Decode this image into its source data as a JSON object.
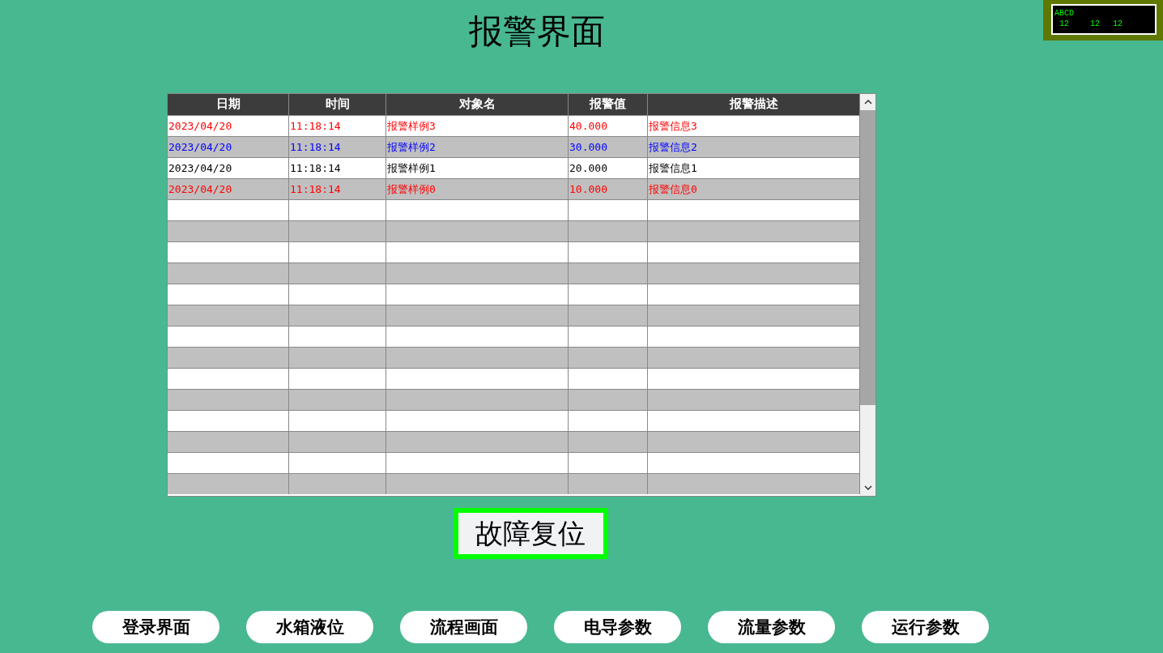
{
  "title": "报警界面",
  "display": {
    "line_1": "ABCD",
    "values": [
      "12",
      "12",
      "12"
    ]
  },
  "table": {
    "columns": [
      "日期",
      "时间",
      "对象名",
      "报警值",
      "报警描述"
    ],
    "rows": [
      {
        "cells": [
          "2023/04/20",
          "11:18:14",
          "报警样例3",
          "40.000",
          "报警信息3"
        ],
        "color": "#ff0000"
      },
      {
        "cells": [
          "2023/04/20",
          "11:18:14",
          "报警样例2",
          "30.000",
          "报警信息2"
        ],
        "color": "#0000ff"
      },
      {
        "cells": [
          "2023/04/20",
          "11:18:14",
          "报警样例1",
          "20.000",
          "报警信息1"
        ],
        "color": "#000000"
      },
      {
        "cells": [
          "2023/04/20",
          "11:18:14",
          "报警样例0",
          "10.000",
          "报警信息0"
        ],
        "color": "#ff0000"
      }
    ]
  },
  "reset_button": "故障复位",
  "nav_buttons": [
    "登录界面",
    "水箱液位",
    "流程画面",
    "电导参数",
    "流量参数",
    "运行参数"
  ]
}
